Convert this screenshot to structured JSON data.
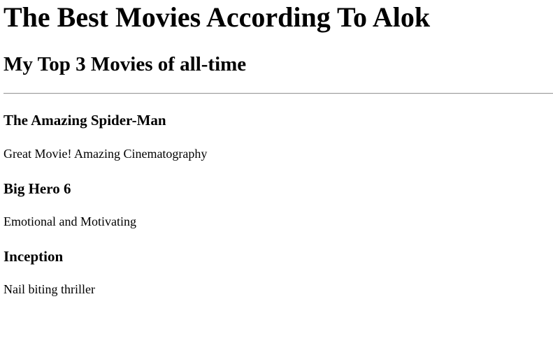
{
  "page": {
    "title": "The Best Movies According To Alok",
    "subtitle": "My Top 3 Movies of all-time"
  },
  "movies": [
    {
      "title": "The Amazing Spider-Man",
      "description": "Great Movie! Amazing Cinematography"
    },
    {
      "title": "Big Hero 6",
      "description": "Emotional and Motivating"
    },
    {
      "title": "Inception",
      "description": "Nail biting thriller"
    }
  ]
}
